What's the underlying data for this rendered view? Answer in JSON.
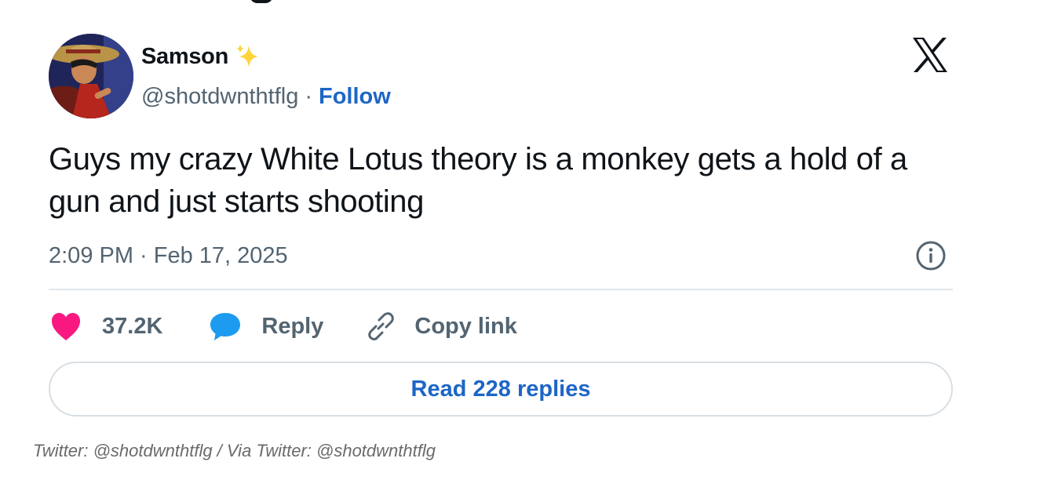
{
  "tweet": {
    "author": {
      "display_name": "Samson",
      "handle": "@shotdwnthtflg",
      "follow_label": "Follow",
      "separator": "·"
    },
    "text": "Guys my crazy White Lotus theory is a monkey gets a hold of a gun and just starts shooting",
    "timestamp": "2:09 PM · Feb 17, 2025",
    "actions": {
      "likes_count": "37.2K",
      "reply_label": "Reply",
      "copy_link_label": "Copy link"
    },
    "read_replies_label": "Read 228 replies"
  },
  "caption": "Twitter: @shotdwnthtflg / Via Twitter: @shotdwnthtflg",
  "icons": {
    "brand": "x-logo-icon",
    "sparkle": "sparkle-icon",
    "info": "info-icon",
    "like": "heart-icon",
    "reply": "speech-bubble-icon",
    "copy": "link-icon"
  },
  "colors": {
    "link": "#1d66c6",
    "heart": "#f91880",
    "reply_bubble": "#1d9bf0",
    "sparkle": "#ffd43b",
    "muted_text": "#536471"
  }
}
